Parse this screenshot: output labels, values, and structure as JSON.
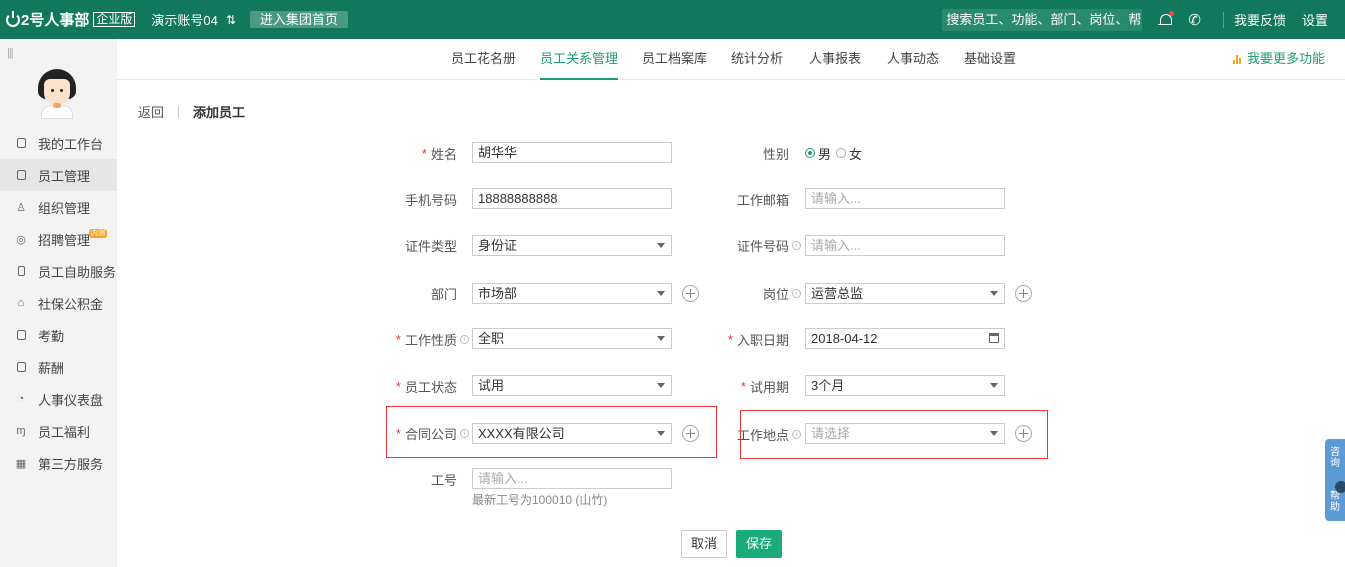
{
  "topbar": {
    "brand": "2号人事部",
    "edition": "企业版",
    "account": "演示账号04",
    "group_home": "进入集团首页",
    "search_placeholder": "搜索员工、功能、部门、岗位、帮助",
    "feedback": "我要反馈",
    "settings": "设置"
  },
  "sidebar": {
    "items": [
      {
        "label": "我的工作台",
        "icon": "monitor-icon"
      },
      {
        "label": "员工管理",
        "icon": "id-card-icon",
        "active": true
      },
      {
        "label": "组织管理",
        "icon": "org-icon"
      },
      {
        "label": "招聘管理",
        "icon": "search-person-icon",
        "badge": "内测"
      },
      {
        "label": "员工自助服务",
        "icon": "mobile-icon"
      },
      {
        "label": "社保公积金",
        "icon": "house-icon"
      },
      {
        "label": "考勤",
        "icon": "calendar-icon"
      },
      {
        "label": "薪酬",
        "icon": "wallet-icon"
      },
      {
        "label": "人事仪表盘",
        "icon": "clock-icon"
      },
      {
        "label": "员工福利",
        "icon": "gift-icon"
      },
      {
        "label": "第三方服务",
        "icon": "apps-icon"
      }
    ]
  },
  "nav": {
    "tabs": [
      "员工花名册",
      "员工关系管理",
      "员工档案库",
      "统计分析",
      "人事报表",
      "人事动态",
      "基础设置"
    ],
    "active": "员工关系管理",
    "more": "我要更多功能"
  },
  "breadcrumb": {
    "back": "返回",
    "current": "添加员工"
  },
  "form": {
    "name": {
      "label": "姓名",
      "value": "胡华华"
    },
    "gender": {
      "label": "性别",
      "options": [
        "男",
        "女"
      ],
      "selected": "男"
    },
    "phone": {
      "label": "手机号码",
      "value": "18888888888"
    },
    "email": {
      "label": "工作邮箱",
      "placeholder": "请输入..."
    },
    "id_type": {
      "label": "证件类型",
      "value": "身份证"
    },
    "id_number": {
      "label": "证件号码",
      "placeholder": "请输入..."
    },
    "department": {
      "label": "部门",
      "value": "市场部"
    },
    "position": {
      "label": "岗位",
      "value": "运营总监"
    },
    "work_type": {
      "label": "工作性质",
      "value": "全职"
    },
    "hire_date": {
      "label": "入职日期",
      "value": "2018-04-12"
    },
    "status": {
      "label": "员工状态",
      "value": "试用"
    },
    "probation": {
      "label": "试用期",
      "value": "3个月"
    },
    "contract_company": {
      "label": "合同公司",
      "value": "XXXX有限公司"
    },
    "work_location": {
      "label": "工作地点",
      "placeholder": "请选择"
    },
    "employee_no": {
      "label": "工号",
      "placeholder": "请输入...",
      "hint": "最新工号为100010 (山竹)"
    }
  },
  "actions": {
    "cancel": "取消",
    "save": "保存"
  },
  "float_help": {
    "consult": "咨询",
    "help": "帮助"
  }
}
